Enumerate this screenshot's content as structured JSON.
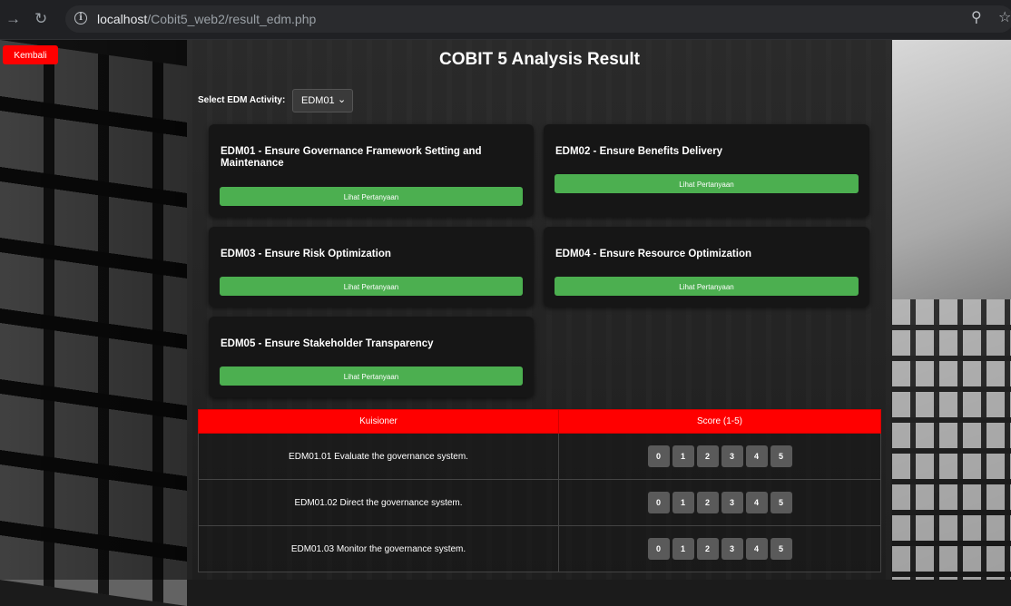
{
  "browser": {
    "url_host": "localhost",
    "url_path": "/Cobit5_web2/result_edm.php"
  },
  "back_button": "Kembali",
  "title": "COBIT 5 Analysis Result",
  "activity_select": {
    "label": "Select EDM Activity:",
    "value": "EDM01"
  },
  "cards": [
    {
      "title": "EDM01 - Ensure Governance Framework Setting and Maintenance",
      "button": "Lihat Pertanyaan"
    },
    {
      "title": "EDM02 - Ensure Benefits Delivery",
      "button": "Lihat Pertanyaan"
    },
    {
      "title": "EDM03 - Ensure Risk Optimization",
      "button": "Lihat Pertanyaan"
    },
    {
      "title": "EDM04 - Ensure Resource Optimization",
      "button": "Lihat Pertanyaan"
    },
    {
      "title": "EDM05 - Ensure Stakeholder Transparency",
      "button": "Lihat Pertanyaan"
    }
  ],
  "table": {
    "headers": [
      "Kuisioner",
      "Score (1-5)"
    ],
    "score_options": [
      "0",
      "1",
      "2",
      "3",
      "4",
      "5"
    ],
    "rows": [
      {
        "question": "EDM01.01 Evaluate the governance system."
      },
      {
        "question": "EDM01.02 Direct the governance system."
      },
      {
        "question": "EDM01.03 Monitor the governance system."
      }
    ]
  },
  "colors": {
    "accent_red": "#ff0000",
    "button_green": "#4caf50",
    "card_bg": "#161616"
  }
}
